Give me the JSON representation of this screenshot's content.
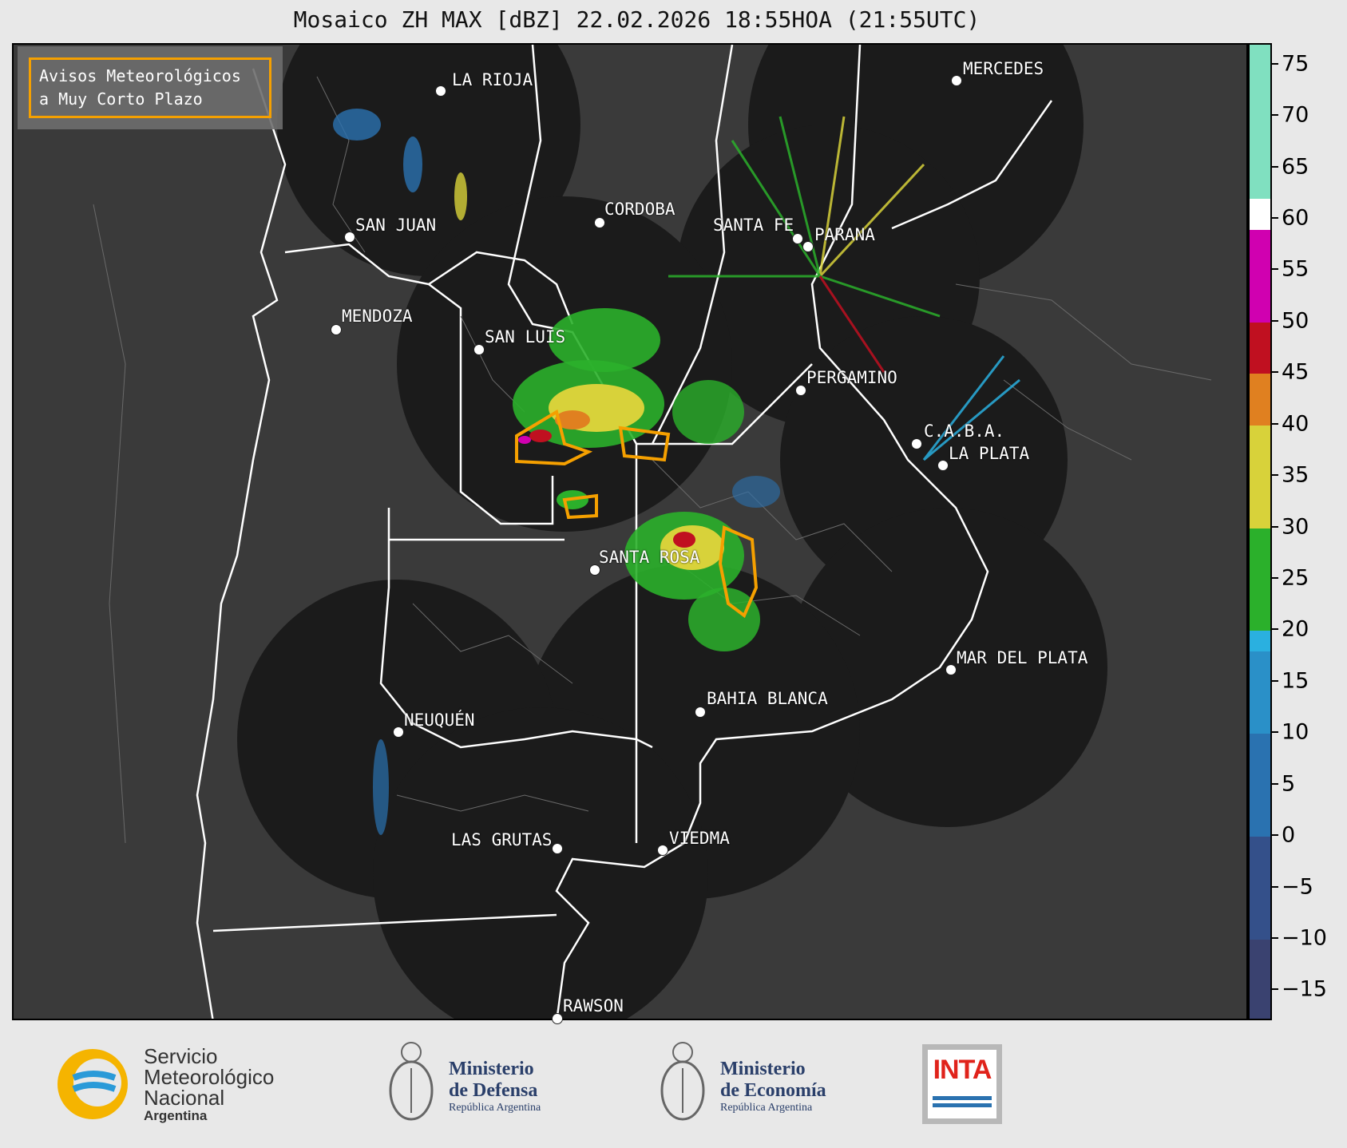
{
  "title": "Mosaico ZH MAX [dBZ] 22.02.2026 18:55HOA (21:55UTC)",
  "legend": {
    "line1": "Avisos Meteorológicos",
    "line2": "a Muy Corto Plazo",
    "color": "#f5a000"
  },
  "cities": [
    {
      "name": "LA RIOJA"
    },
    {
      "name": "MERCEDES"
    },
    {
      "name": "CORDOBA"
    },
    {
      "name": "SAN JUAN"
    },
    {
      "name": "SANTA FE"
    },
    {
      "name": "PARANA"
    },
    {
      "name": "MENDOZA"
    },
    {
      "name": "SAN LUIS"
    },
    {
      "name": "PERGAMINO"
    },
    {
      "name": "C.A.B.A."
    },
    {
      "name": "LA PLATA"
    },
    {
      "name": "SANTA ROSA"
    },
    {
      "name": "MAR DEL PLATA"
    },
    {
      "name": "BAHIA BLANCA"
    },
    {
      "name": "NEUQUÉN"
    },
    {
      "name": "LAS GRUTAS"
    },
    {
      "name": "VIEDMA"
    },
    {
      "name": "RAWSON"
    }
  ],
  "colorbar": {
    "min": -18,
    "max": 77,
    "ticks": [
      "75",
      "70",
      "65",
      "60",
      "55",
      "50",
      "45",
      "40",
      "35",
      "30",
      "25",
      "20",
      "15",
      "10",
      "5",
      "0",
      "−5",
      "−10",
      "−15"
    ],
    "tick_values": [
      75,
      70,
      65,
      60,
      55,
      50,
      45,
      40,
      35,
      30,
      25,
      20,
      15,
      10,
      5,
      0,
      -5,
      -10,
      -15
    ],
    "colors": {
      "deep": "#3a4270",
      "blue": "#2a72b0",
      "cyan": "#2ab0e0",
      "green": "#2bb02b",
      "yellow": "#d8d23a",
      "orange": "#e08020",
      "red": "#c01020",
      "magenta": "#d000b0",
      "white": "#ffffff",
      "teal": "#80e0c0"
    }
  },
  "footer": {
    "smn": {
      "line1": "Servicio",
      "line2": "Meteorológico",
      "line3": "Nacional",
      "line4": "Argentina"
    },
    "defensa": {
      "line1": "Ministerio",
      "line2": "de Defensa",
      "line3": "República Argentina"
    },
    "economia": {
      "line1": "Ministerio",
      "line2": "de Economía",
      "line3": "República Argentina"
    },
    "inta": {
      "text": "INTA"
    }
  }
}
